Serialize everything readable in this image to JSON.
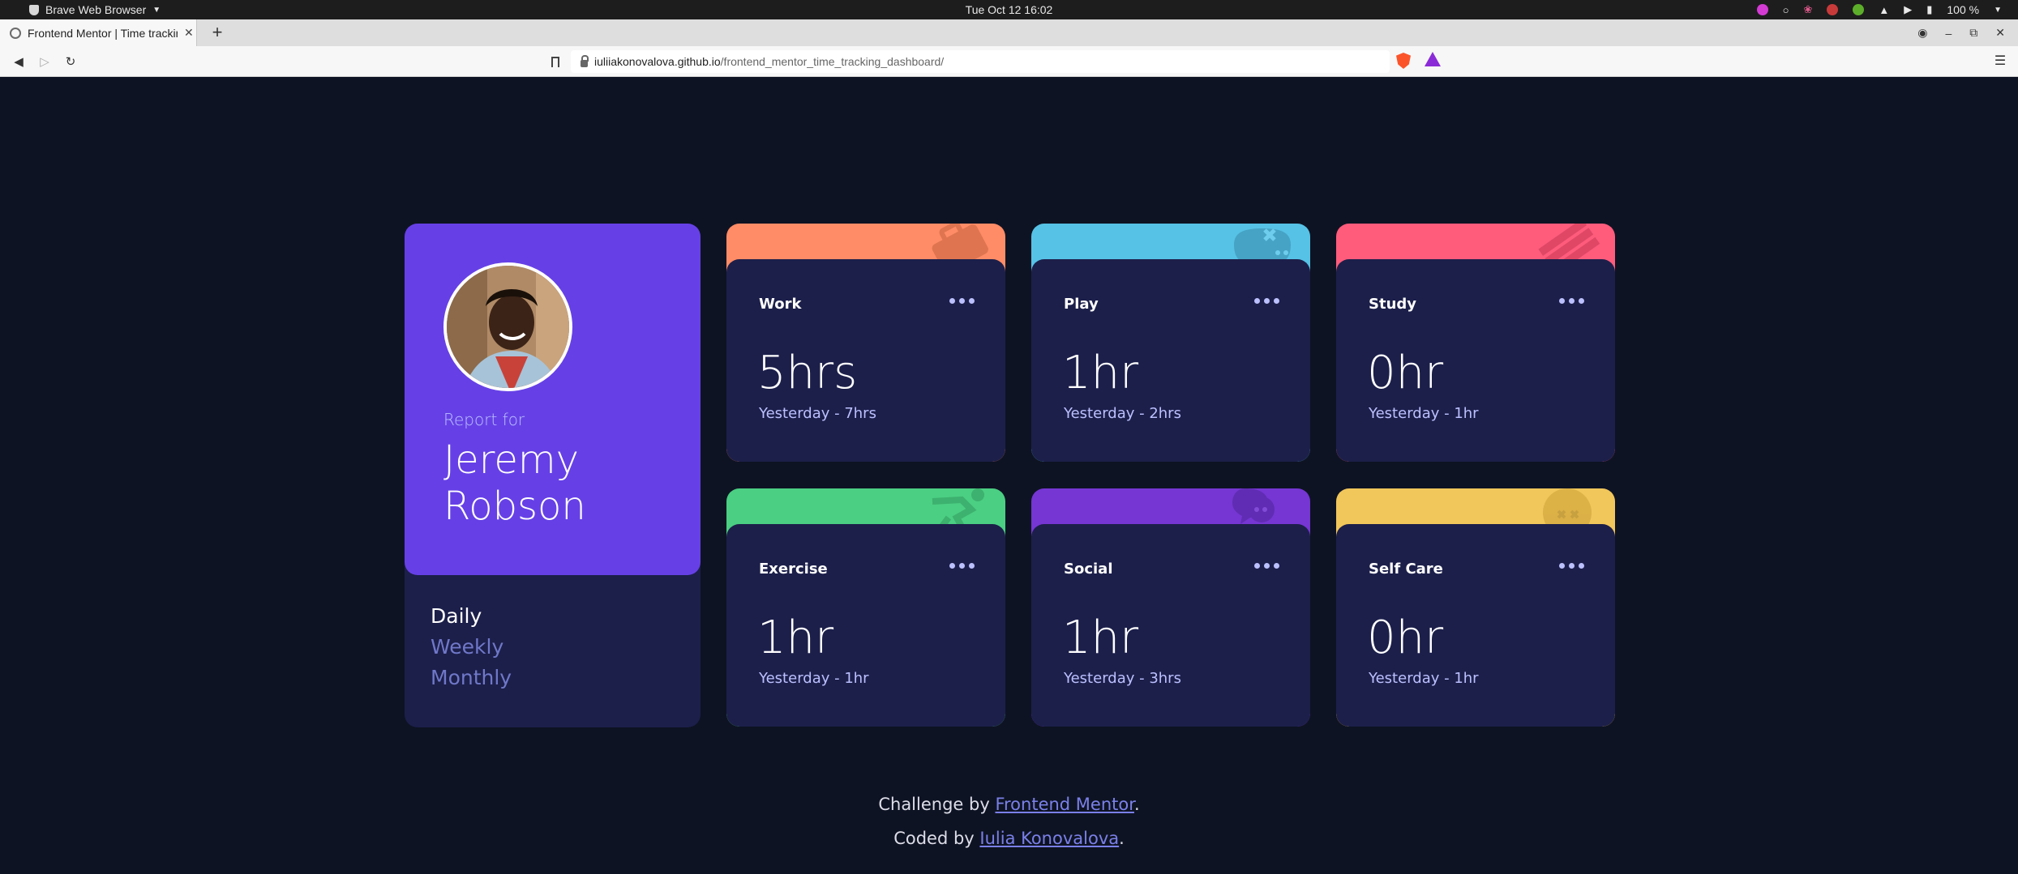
{
  "os": {
    "app_menu": "Brave Web Browser",
    "clock": "Tue Oct 12  16:02",
    "battery": "100 %"
  },
  "browser": {
    "tab_title": "Frontend Mentor | Time tracking dashboard",
    "url_host": "iuliiakonovalova.github.io",
    "url_path": "/frontend_mentor_time_tracking_dashboard/"
  },
  "profile": {
    "report_label": "Report for",
    "name_first": "Jeremy",
    "name_last": "Robson",
    "periods": [
      "Daily",
      "Weekly",
      "Monthly"
    ],
    "active_period": "Daily"
  },
  "cards": [
    {
      "title": "Work",
      "current": "5hrs",
      "previous": "Yesterday - 7hrs",
      "color": "#ff8c66",
      "icon": "briefcase-icon"
    },
    {
      "title": "Play",
      "current": "1hr",
      "previous": "Yesterday - 2hrs",
      "color": "#56c2e6",
      "icon": "gamepad-icon"
    },
    {
      "title": "Study",
      "current": "0hr",
      "previous": "Yesterday - 1hr",
      "color": "#ff5c7c",
      "icon": "book-icon"
    },
    {
      "title": "Exercise",
      "current": "1hr",
      "previous": "Yesterday - 1hr",
      "color": "#4bcf83",
      "icon": "runner-icon"
    },
    {
      "title": "Social",
      "current": "1hr",
      "previous": "Yesterday - 3hrs",
      "color": "#7536d3",
      "icon": "chat-icon"
    },
    {
      "title": "Self Care",
      "current": "0hr",
      "previous": "Yesterday - 1hr",
      "color": "#f1c65b",
      "icon": "heart-icon"
    }
  ],
  "footer": {
    "challenge_prefix": "Challenge by ",
    "challenge_link": "Frontend Mentor",
    "coded_prefix": "Coded by ",
    "coded_link": "Iulia Konovalova",
    "suffix": "."
  },
  "colors": {
    "background": "#0e1323",
    "card_body": "#1c1f4a",
    "profile_accent": "#6640e6",
    "pale_blue": "#bbc0ff",
    "desaturated_blue": "#7078c9"
  }
}
